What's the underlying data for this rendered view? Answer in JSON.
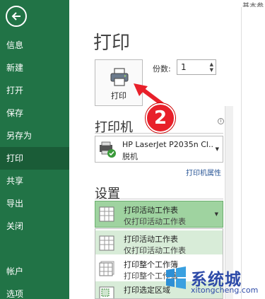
{
  "header": {
    "top_right": "基本参"
  },
  "sidebar": {
    "items": [
      {
        "label": "信息"
      },
      {
        "label": "新建"
      },
      {
        "label": "打开"
      },
      {
        "label": "保存"
      },
      {
        "label": "另存为"
      },
      {
        "label": "打印",
        "active": true
      },
      {
        "label": "共享"
      },
      {
        "label": "导出"
      },
      {
        "label": "关闭"
      },
      {
        "label": ""
      },
      {
        "label": "帐户"
      },
      {
        "label": "选项"
      }
    ]
  },
  "main": {
    "title": "打印",
    "print_button": "打印",
    "copies_label": "份数:",
    "copies_value": "1",
    "printer_section": "打印机",
    "printer_name": "HP LaserJet P2035n Cl...",
    "printer_status": "脱机",
    "printer_properties": "打印机属性",
    "settings_section": "设置",
    "settings_selected": {
      "title": "打印活动工作表",
      "sub": "仅打印活动工作表"
    },
    "settings_options": [
      {
        "title": "打印活动工作表",
        "sub": "仅打印活动工作表"
      },
      {
        "title": "打印整个工作簿",
        "sub": "打印整个工作簿"
      },
      {
        "title": "打印选定区域",
        "sub": ""
      }
    ]
  },
  "annotation": {
    "badge": "2"
  },
  "watermark": {
    "name": "系统城",
    "url": "xitongcheng.com"
  },
  "colors": {
    "sidebar": "#217346",
    "sidebar_active": "#1a5c37",
    "selected": "#9fd3a0",
    "badge": "#e8202a",
    "watermark": "#2d4aa8"
  }
}
